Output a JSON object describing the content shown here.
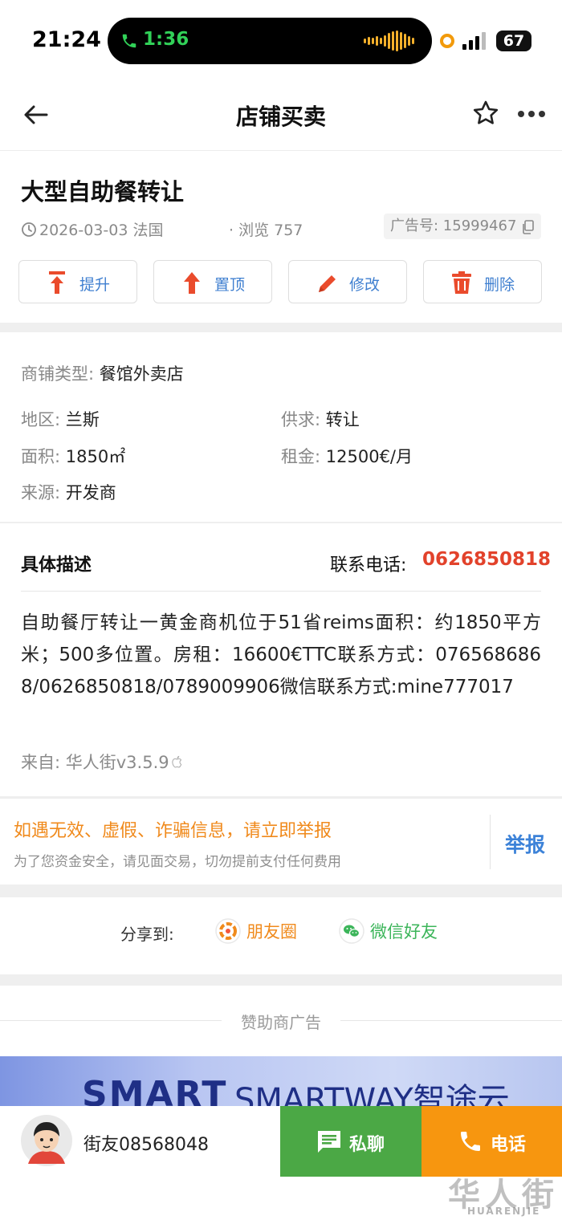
{
  "status_bar": {
    "time": "21:24",
    "call_time": "1:36",
    "battery": "67"
  },
  "nav": {
    "title": "店铺买卖"
  },
  "post": {
    "title": "大型自助餐转让",
    "date_location": "2026-03-03 法国",
    "views": "· 浏览 757",
    "ad_id": "广告号: 15999467"
  },
  "actions": [
    {
      "label": "提升",
      "color": "#ea4b2c"
    },
    {
      "label": "置顶",
      "color": "#ea4b2c"
    },
    {
      "label": "修改",
      "color": "#ea4b2c"
    },
    {
      "label": "删除",
      "color": "#ea4b2c"
    }
  ],
  "details": {
    "shop_type": {
      "key": "商铺类型: ",
      "value": "餐馆外卖店"
    },
    "region": {
      "key": "地区: ",
      "value": "兰斯"
    },
    "supply": {
      "key": "供求: ",
      "value": "转让"
    },
    "area": {
      "key": "面积: ",
      "value": "1850㎡"
    },
    "rent": {
      "key": "租金: ",
      "value": "12500€/月"
    },
    "source": {
      "key": "来源: ",
      "value": "开发商"
    }
  },
  "description": {
    "label": "具体描述",
    "phone_label": "联系电话: ",
    "phone": "0626850818",
    "text": "自助餐厅转让一黄金商机位于51省reims面积：约1850平方米；500多位置。房租：16600€TTC联系方式：0765686868/0626850818/0789009906微信联系方式:mine777017",
    "from": "来自: 华人街v3.5.9"
  },
  "report": {
    "warning": "如遇无效、虚假、诈骗信息，请立即举报",
    "sub": "为了您资金安全，请见面交易，切勿提前支付任何费用",
    "button": "举报"
  },
  "share": {
    "label": "分享到:",
    "moments": "朋友圈",
    "wechat": "微信好友"
  },
  "sponsor": {
    "label": "赞助商广告",
    "banner_logo": "SMART",
    "banner_text": "SMARTWAY智途云"
  },
  "bottom": {
    "user": "街友08568048",
    "chat": "私聊",
    "call": "电话",
    "watermark": "华人街",
    "watermark_sub": "HUARENJIE"
  }
}
